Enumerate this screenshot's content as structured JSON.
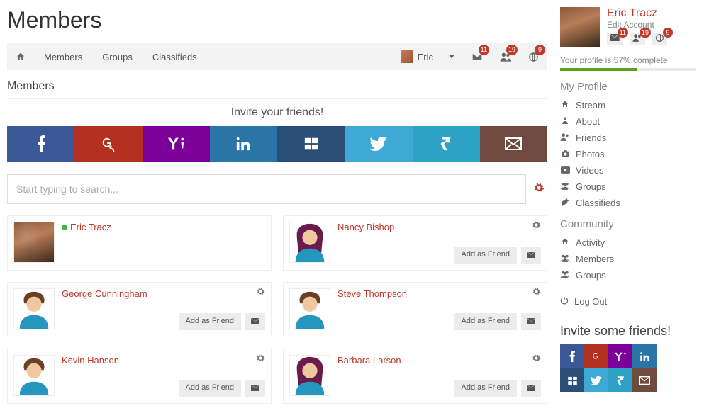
{
  "page_title": "Members",
  "sub_title": "Members",
  "navbar": {
    "items": [
      "Members",
      "Groups",
      "Classifieds"
    ],
    "user": "Eric",
    "badges": {
      "mail": "11",
      "friends": "19",
      "globe": "9"
    }
  },
  "invite_heading": "Invite your friends!",
  "search_placeholder": "Start typing to search...",
  "add_friend_label": "Add as Friend",
  "members": [
    {
      "name": "Eric Tracz",
      "online": true,
      "self": true,
      "gender": "photo"
    },
    {
      "name": "Nancy Bishop",
      "online": false,
      "self": false,
      "gender": "f"
    },
    {
      "name": "George Cunningham",
      "online": false,
      "self": false,
      "gender": "m"
    },
    {
      "name": "Steve Thompson",
      "online": false,
      "self": false,
      "gender": "m"
    },
    {
      "name": "Kevin Hanson",
      "online": false,
      "self": false,
      "gender": "m"
    },
    {
      "name": "Barbara Larson",
      "online": false,
      "self": false,
      "gender": "f"
    }
  ],
  "sidebar": {
    "username": "Eric Tracz",
    "edit": "Edit Account",
    "badges": {
      "mail": "11",
      "friends": "19",
      "globe": "9"
    },
    "progress_label": "Your profile is 57% complete",
    "progress_pct": 57,
    "sections": {
      "profile_title": "My Profile",
      "profile_links": [
        "Stream",
        "About",
        "Friends",
        "Photos",
        "Videos",
        "Groups",
        "Classifieds"
      ],
      "community_title": "Community",
      "community_links": [
        "Activity",
        "Members",
        "Groups"
      ]
    },
    "logout": "Log Out",
    "invite_title": "Invite some friends!"
  }
}
